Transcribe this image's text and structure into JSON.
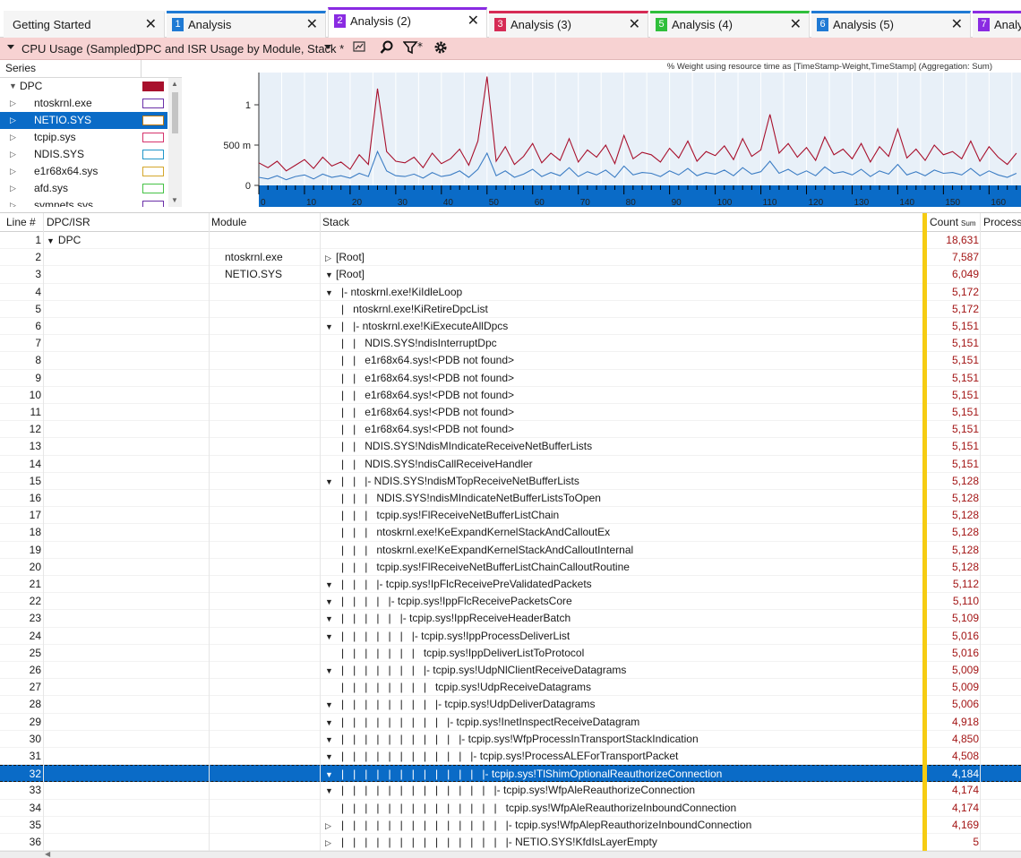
{
  "tabs": [
    {
      "label": "Getting Started",
      "num": "",
      "color": ""
    },
    {
      "label": "Analysis",
      "num": "1",
      "color": "#1f7ad4"
    },
    {
      "label": "Analysis (2)",
      "num": "2",
      "color": "#8a2be2"
    },
    {
      "label": "Analysis (3)",
      "num": "3",
      "color": "#d62b55"
    },
    {
      "label": "Analysis (4)",
      "num": "5",
      "color": "#2fbf3b"
    },
    {
      "label": "Analysis (5)",
      "num": "6",
      "color": "#1f7ad4"
    },
    {
      "label": "Analy",
      "num": "7",
      "color": "#8a2be2"
    }
  ],
  "toolbar": {
    "graph_name": "CPU Usage (Sampled)",
    "preset_name": "DPC and ISR Usage by Module, Stack *",
    "icons": [
      "chart-icon",
      "search-icon",
      "filter-icon",
      "gear-icon"
    ]
  },
  "series": {
    "header": "Series",
    "items": [
      {
        "label": "DPC",
        "color": "#a8102c",
        "filled": true,
        "selected": false,
        "level": 0,
        "expander": "▼"
      },
      {
        "label": "ntoskrnl.exe",
        "color": "#6a2fa8",
        "filled": false,
        "selected": false,
        "level": 1,
        "expander": "▷"
      },
      {
        "label": "NETIO.SYS",
        "color": "#c07a10",
        "filled": false,
        "selected": true,
        "level": 1,
        "expander": "▷"
      },
      {
        "label": "tcpip.sys",
        "color": "#d6336c",
        "filled": false,
        "selected": false,
        "level": 1,
        "expander": "▷"
      },
      {
        "label": "NDIS.SYS",
        "color": "#2196c9",
        "filled": false,
        "selected": false,
        "level": 1,
        "expander": "▷"
      },
      {
        "label": "e1r68x64.sys",
        "color": "#d4a72c",
        "filled": false,
        "selected": false,
        "level": 1,
        "expander": "▷"
      },
      {
        "label": "afd.sys",
        "color": "#46c246",
        "filled": false,
        "selected": false,
        "level": 1,
        "expander": "▷"
      },
      {
        "label": "symnets.sys",
        "color": "#6a2fa8",
        "filled": false,
        "selected": false,
        "level": 1,
        "expander": "▷"
      }
    ]
  },
  "chart_data": {
    "type": "line",
    "title": "% Weight using resource time as [TimeStamp-Weight,TimeStamp] (Aggregation: Sum)",
    "xlabel": "",
    "ylabel": "",
    "xlim": [
      0,
      167
    ],
    "ylim": [
      0,
      1.4
    ],
    "yticks": [
      {
        "value": 0,
        "label": "0"
      },
      {
        "value": 0.5,
        "label": "500 m"
      },
      {
        "value": 1,
        "label": "1"
      }
    ],
    "xticks": [
      0,
      10,
      20,
      30,
      40,
      50,
      60,
      70,
      80,
      90,
      100,
      110,
      120,
      130,
      140,
      150,
      160
    ],
    "x": [
      0,
      2,
      4,
      6,
      8,
      10,
      12,
      14,
      16,
      18,
      20,
      22,
      24,
      26,
      28,
      30,
      32,
      34,
      36,
      38,
      40,
      42,
      44,
      46,
      48,
      50,
      52,
      54,
      56,
      58,
      60,
      62,
      64,
      66,
      68,
      70,
      72,
      74,
      76,
      78,
      80,
      82,
      84,
      86,
      88,
      90,
      92,
      94,
      96,
      98,
      100,
      102,
      104,
      106,
      108,
      110,
      112,
      114,
      116,
      118,
      120,
      122,
      124,
      126,
      128,
      130,
      132,
      134,
      136,
      138,
      140,
      142,
      144,
      146,
      148,
      150,
      152,
      154,
      156,
      158,
      160,
      162,
      164,
      166
    ],
    "series": [
      {
        "name": "DPC",
        "color": "#a8102c",
        "values": [
          0.28,
          0.22,
          0.3,
          0.18,
          0.25,
          0.32,
          0.21,
          0.35,
          0.24,
          0.29,
          0.2,
          0.38,
          0.26,
          1.2,
          0.42,
          0.3,
          0.28,
          0.35,
          0.22,
          0.4,
          0.27,
          0.33,
          0.45,
          0.25,
          0.55,
          1.35,
          0.3,
          0.48,
          0.26,
          0.36,
          0.52,
          0.28,
          0.4,
          0.31,
          0.58,
          0.29,
          0.44,
          0.35,
          0.5,
          0.27,
          0.62,
          0.33,
          0.41,
          0.38,
          0.29,
          0.46,
          0.34,
          0.55,
          0.3,
          0.42,
          0.37,
          0.49,
          0.32,
          0.58,
          0.36,
          0.44,
          0.88,
          0.4,
          0.52,
          0.35,
          0.47,
          0.31,
          0.6,
          0.38,
          0.45,
          0.33,
          0.52,
          0.29,
          0.48,
          0.36,
          0.7,
          0.34,
          0.45,
          0.31,
          0.5,
          0.38,
          0.42,
          0.33,
          0.55,
          0.3,
          0.48,
          0.35,
          0.26,
          0.4
        ]
      },
      {
        "name": "NETIO.SYS",
        "color": "#3c7dc4",
        "values": [
          0.1,
          0.08,
          0.12,
          0.07,
          0.11,
          0.13,
          0.08,
          0.14,
          0.1,
          0.12,
          0.09,
          0.15,
          0.11,
          0.42,
          0.18,
          0.12,
          0.11,
          0.14,
          0.09,
          0.16,
          0.11,
          0.13,
          0.18,
          0.1,
          0.2,
          0.4,
          0.12,
          0.18,
          0.1,
          0.14,
          0.2,
          0.11,
          0.16,
          0.12,
          0.22,
          0.11,
          0.17,
          0.13,
          0.19,
          0.1,
          0.24,
          0.13,
          0.16,
          0.15,
          0.11,
          0.18,
          0.13,
          0.21,
          0.12,
          0.16,
          0.14,
          0.19,
          0.12,
          0.22,
          0.14,
          0.17,
          0.3,
          0.15,
          0.2,
          0.13,
          0.18,
          0.12,
          0.23,
          0.15,
          0.17,
          0.13,
          0.2,
          0.11,
          0.18,
          0.14,
          0.26,
          0.13,
          0.17,
          0.12,
          0.19,
          0.15,
          0.16,
          0.13,
          0.21,
          0.12,
          0.18,
          0.13,
          0.1,
          0.15
        ]
      }
    ]
  },
  "grid": {
    "columns": {
      "line": "Line #",
      "dpc": "DPC/ISR",
      "module": "Module",
      "stack": "Stack",
      "count": "Count",
      "count_sub": "Sum",
      "process": "Process"
    },
    "rows": [
      {
        "line": "1",
        "dpc": "DPC",
        "dpc_exp": "▼",
        "module": "",
        "stack": "",
        "indent": 0,
        "exp": "",
        "count": "18,631"
      },
      {
        "line": "2",
        "dpc": "",
        "module": "ntoskrnl.exe",
        "stack": "[Root]",
        "indent": 0,
        "exp": "▷",
        "count": "7,587"
      },
      {
        "line": "3",
        "dpc": "",
        "module": "NETIO.SYS",
        "stack": "[Root]",
        "indent": 0,
        "exp": "▼",
        "count": "6,049"
      },
      {
        "line": "4",
        "dpc": "",
        "module": "",
        "stack": "|- ntoskrnl.exe!KiIdleLoop",
        "indent": 0,
        "exp": "▼",
        "count": "5,172"
      },
      {
        "line": "5",
        "dpc": "",
        "module": "",
        "stack": "|   ntoskrnl.exe!KiRetireDpcList",
        "indent": 0,
        "exp": "",
        "count": "5,172"
      },
      {
        "line": "6",
        "dpc": "",
        "module": "",
        "stack": "|   |- ntoskrnl.exe!KiExecuteAllDpcs",
        "indent": 0,
        "exp": "▼",
        "count": "5,151"
      },
      {
        "line": "7",
        "dpc": "",
        "module": "",
        "stack": "|   |   NDIS.SYS!ndisInterruptDpc",
        "indent": 0,
        "exp": "",
        "count": "5,151"
      },
      {
        "line": "8",
        "dpc": "",
        "module": "",
        "stack": "|   |   e1r68x64.sys!<PDB not found>",
        "indent": 0,
        "exp": "",
        "count": "5,151"
      },
      {
        "line": "9",
        "dpc": "",
        "module": "",
        "stack": "|   |   e1r68x64.sys!<PDB not found>",
        "indent": 0,
        "exp": "",
        "count": "5,151"
      },
      {
        "line": "10",
        "dpc": "",
        "module": "",
        "stack": "|   |   e1r68x64.sys!<PDB not found>",
        "indent": 0,
        "exp": "",
        "count": "5,151"
      },
      {
        "line": "11",
        "dpc": "",
        "module": "",
        "stack": "|   |   e1r68x64.sys!<PDB not found>",
        "indent": 0,
        "exp": "",
        "count": "5,151"
      },
      {
        "line": "12",
        "dpc": "",
        "module": "",
        "stack": "|   |   e1r68x64.sys!<PDB not found>",
        "indent": 0,
        "exp": "",
        "count": "5,151"
      },
      {
        "line": "13",
        "dpc": "",
        "module": "",
        "stack": "|   |   NDIS.SYS!NdisMIndicateReceiveNetBufferLists",
        "indent": 0,
        "exp": "",
        "count": "5,151"
      },
      {
        "line": "14",
        "dpc": "",
        "module": "",
        "stack": "|   |   NDIS.SYS!ndisCallReceiveHandler",
        "indent": 0,
        "exp": "",
        "count": "5,151"
      },
      {
        "line": "15",
        "dpc": "",
        "module": "",
        "stack": "|   |   |- NDIS.SYS!ndisMTopReceiveNetBufferLists",
        "indent": 0,
        "exp": "▼",
        "count": "5,128"
      },
      {
        "line": "16",
        "dpc": "",
        "module": "",
        "stack": "|   |   |   NDIS.SYS!ndisMIndicateNetBufferListsToOpen",
        "indent": 0,
        "exp": "",
        "count": "5,128"
      },
      {
        "line": "17",
        "dpc": "",
        "module": "",
        "stack": "|   |   |   tcpip.sys!FlReceiveNetBufferListChain",
        "indent": 0,
        "exp": "",
        "count": "5,128"
      },
      {
        "line": "18",
        "dpc": "",
        "module": "",
        "stack": "|   |   |   ntoskrnl.exe!KeExpandKernelStackAndCalloutEx",
        "indent": 0,
        "exp": "",
        "count": "5,128"
      },
      {
        "line": "19",
        "dpc": "",
        "module": "",
        "stack": "|   |   |   ntoskrnl.exe!KeExpandKernelStackAndCalloutInternal",
        "indent": 0,
        "exp": "",
        "count": "5,128"
      },
      {
        "line": "20",
        "dpc": "",
        "module": "",
        "stack": "|   |   |   tcpip.sys!FlReceiveNetBufferListChainCalloutRoutine",
        "indent": 0,
        "exp": "",
        "count": "5,128"
      },
      {
        "line": "21",
        "dpc": "",
        "module": "",
        "stack": "|   |   |   |- tcpip.sys!IpFlcReceivePreValidatedPackets",
        "indent": 0,
        "exp": "▼",
        "count": "5,112"
      },
      {
        "line": "22",
        "dpc": "",
        "module": "",
        "stack": "|   |   |   |   |- tcpip.sys!IppFlcReceivePacketsCore",
        "indent": 0,
        "exp": "▼",
        "count": "5,110"
      },
      {
        "line": "23",
        "dpc": "",
        "module": "",
        "stack": "|   |   |   |   |   |- tcpip.sys!IppReceiveHeaderBatch",
        "indent": 0,
        "exp": "▼",
        "count": "5,109"
      },
      {
        "line": "24",
        "dpc": "",
        "module": "",
        "stack": "|   |   |   |   |   |   |- tcpip.sys!IppProcessDeliverList",
        "indent": 0,
        "exp": "▼",
        "count": "5,016"
      },
      {
        "line": "25",
        "dpc": "",
        "module": "",
        "stack": "|   |   |   |   |   |   |   tcpip.sys!IppDeliverListToProtocol",
        "indent": 0,
        "exp": "",
        "count": "5,016"
      },
      {
        "line": "26",
        "dpc": "",
        "module": "",
        "stack": "|   |   |   |   |   |   |   |- tcpip.sys!UdpNlClientReceiveDatagrams",
        "indent": 0,
        "exp": "▼",
        "count": "5,009"
      },
      {
        "line": "27",
        "dpc": "",
        "module": "",
        "stack": "|   |   |   |   |   |   |   |   tcpip.sys!UdpReceiveDatagrams",
        "indent": 0,
        "exp": "",
        "count": "5,009"
      },
      {
        "line": "28",
        "dpc": "",
        "module": "",
        "stack": "|   |   |   |   |   |   |   |   |- tcpip.sys!UdpDeliverDatagrams",
        "indent": 0,
        "exp": "▼",
        "count": "5,006"
      },
      {
        "line": "29",
        "dpc": "",
        "module": "",
        "stack": "|   |   |   |   |   |   |   |   |   |- tcpip.sys!InetInspectReceiveDatagram",
        "indent": 0,
        "exp": "▼",
        "count": "4,918"
      },
      {
        "line": "30",
        "dpc": "",
        "module": "",
        "stack": "|   |   |   |   |   |   |   |   |   |   |- tcpip.sys!WfpProcessInTransportStackIndication",
        "indent": 0,
        "exp": "▼",
        "count": "4,850"
      },
      {
        "line": "31",
        "dpc": "",
        "module": "",
        "stack": "|   |   |   |   |   |   |   |   |   |   |   |- tcpip.sys!ProcessALEForTransportPacket",
        "indent": 0,
        "exp": "▼",
        "count": "4,508"
      },
      {
        "line": "32",
        "dpc": "",
        "module": "",
        "stack": "|   |   |   |   |   |   |   |   |   |   |   |   |- tcpip.sys!TlShimOptionalReauthorizeConnection",
        "indent": 0,
        "exp": "▼",
        "count": "4,184",
        "selected": true
      },
      {
        "line": "33",
        "dpc": "",
        "module": "",
        "stack": "|   |   |   |   |   |   |   |   |   |   |   |   |   |- tcpip.sys!WfpAleReauthorizeConnection",
        "indent": 0,
        "exp": "▼",
        "count": "4,174"
      },
      {
        "line": "34",
        "dpc": "",
        "module": "",
        "stack": "|   |   |   |   |   |   |   |   |   |   |   |   |   |   tcpip.sys!WfpAleReauthorizeInboundConnection",
        "indent": 0,
        "exp": "",
        "count": "4,174"
      },
      {
        "line": "35",
        "dpc": "",
        "module": "",
        "stack": "|   |   |   |   |   |   |   |   |   |   |   |   |   |   |- tcpip.sys!WfpAlepReauthorizeInboundConnection",
        "indent": 0,
        "exp": "▷",
        "count": "4,169"
      },
      {
        "line": "36",
        "dpc": "",
        "module": "",
        "stack": "|   |   |   |   |   |   |   |   |   |   |   |   |   |   |- NETIO.SYS!KfdIsLayerEmpty",
        "indent": 0,
        "exp": "▷",
        "count": "5"
      }
    ]
  }
}
